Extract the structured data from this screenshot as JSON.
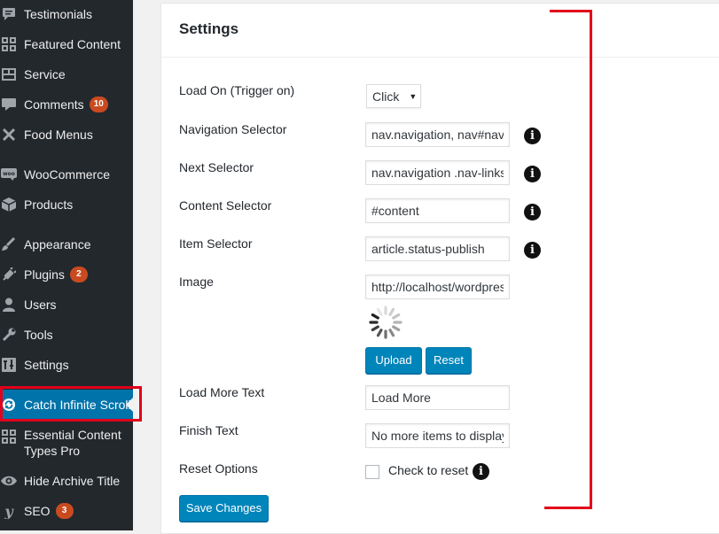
{
  "sidebar": {
    "items": [
      {
        "label": "Testimonials",
        "icon": "testimonial-icon"
      },
      {
        "label": "Featured Content",
        "icon": "grid-icon"
      },
      {
        "label": "Service",
        "icon": "service-icon"
      },
      {
        "label": "Comments",
        "icon": "comment-icon",
        "badge": "10"
      },
      {
        "label": "Food Menus",
        "icon": "cutlery-icon"
      },
      {
        "label": "WooCommerce",
        "icon": "woocommerce-icon"
      },
      {
        "label": "Products",
        "icon": "box-icon"
      },
      {
        "label": "Appearance",
        "icon": "brush-icon"
      },
      {
        "label": "Plugins",
        "icon": "plug-icon",
        "badge": "2"
      },
      {
        "label": "Users",
        "icon": "user-icon"
      },
      {
        "label": "Tools",
        "icon": "wrench-icon"
      },
      {
        "label": "Settings",
        "icon": "settings-icon"
      },
      {
        "label": "Catch Infinite Scroll",
        "icon": "refresh-icon",
        "current": true
      },
      {
        "label": "Essential Content Types Pro",
        "icon": "grid-icon"
      },
      {
        "label": "Hide Archive Title",
        "icon": "eye-icon"
      },
      {
        "label": "SEO",
        "icon": "yoast-icon",
        "badge": "3"
      }
    ]
  },
  "settings": {
    "title": "Settings",
    "load_on": {
      "label": "Load On (Trigger on)",
      "value": "Click"
    },
    "navigation_selector": {
      "label": "Navigation Selector",
      "value": "nav.navigation, nav#nav-below"
    },
    "next_selector": {
      "label": "Next Selector",
      "value": "nav.navigation .nav-links a.next"
    },
    "content_selector": {
      "label": "Content Selector",
      "value": "#content"
    },
    "item_selector": {
      "label": "Item Selector",
      "value": "article.status-publish"
    },
    "image": {
      "label": "Image",
      "value": "http://localhost/wordpress",
      "upload_label": "Upload",
      "reset_label": "Reset"
    },
    "load_more_text": {
      "label": "Load More Text",
      "value": "Load More"
    },
    "finish_text": {
      "label": "Finish Text",
      "value": "No more items to display"
    },
    "reset_options": {
      "label": "Reset Options",
      "check_label": "Check to reset"
    },
    "info_glyph": "i",
    "save_label": "Save Changes"
  },
  "colors": {
    "sidebar_bg": "#23282d",
    "menu_current": "#0073aa",
    "button_primary": "#0085ba",
    "badge": "#ca4a1f",
    "annotation_red": "#e2001a"
  }
}
